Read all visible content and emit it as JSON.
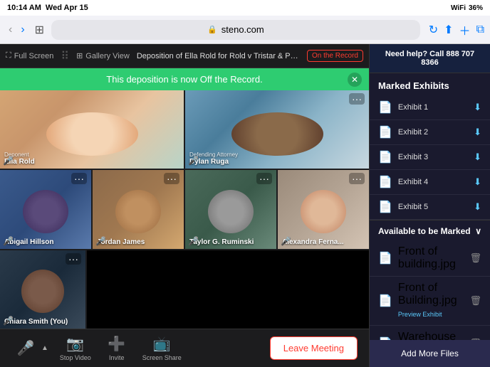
{
  "statusBar": {
    "time": "10:14 AM",
    "date": "Wed Apr 15",
    "wifi": "WiFi",
    "battery": "36%"
  },
  "browserBar": {
    "readerMode": "AA",
    "url": "steno.com",
    "lockLabel": "🔒"
  },
  "videoToolbar": {
    "fullscreen": "Full Screen",
    "galleryView": "Gallery View",
    "depositionTitle": "Deposition of Ella Rold for Rold v Tristar & Pioneer Public Industries",
    "onRecord": "On the Record"
  },
  "offRecordBanner": {
    "message": "This deposition is now Off the Record."
  },
  "participants": [
    {
      "name": "Ella Rold",
      "role": "Deponent",
      "bg": "ella",
      "col": 1,
      "row": 1
    },
    {
      "name": "Dylan Ruga",
      "role": "Defending Attorney",
      "bg": "dylan",
      "col": 2,
      "row": 1
    },
    {
      "name": "Abigail Hillson",
      "role": "",
      "bg": "abigail",
      "col": 1,
      "row": 2
    },
    {
      "name": "Jordan James",
      "role": "",
      "bg": "jordan",
      "col": 2,
      "row": 2
    },
    {
      "name": "Taylor G. Ruminski",
      "role": "",
      "bg": "taylor",
      "col": 3,
      "row": 2
    },
    {
      "name": "Alexandra Ferna...",
      "role": "",
      "bg": "alexandra",
      "col": 4,
      "row": 2
    },
    {
      "name": "Chiara Smith (You)",
      "role": "",
      "bg": "chiara",
      "col": 1,
      "row": 3
    }
  ],
  "controls": {
    "mute": "Mute",
    "stopVideo": "Stop Video",
    "invite": "Invite",
    "screenShare": "Screen Share",
    "leaveMeeting": "Leave Meeting"
  },
  "rightPanel": {
    "helpText": "Need help? Call 888 707 8366",
    "markedExhibitsTitle": "Marked Exhibits",
    "exhibits": [
      {
        "name": "Exhibit 1"
      },
      {
        "name": "Exhibit 2"
      },
      {
        "name": "Exhibit 3"
      },
      {
        "name": "Exhibit 4"
      },
      {
        "name": "Exhibit 5"
      }
    ],
    "availableTitle": "Available to be Marked",
    "availableFiles": [
      {
        "name": "Front of building.jpg",
        "subLabel": ""
      },
      {
        "name": "Front of Building.jpg",
        "subLabel": "Preview Exhibit"
      },
      {
        "name": "Warehouse Floor.jpg",
        "subLabel": ""
      }
    ],
    "addMoreLabel": "Add More Files"
  }
}
